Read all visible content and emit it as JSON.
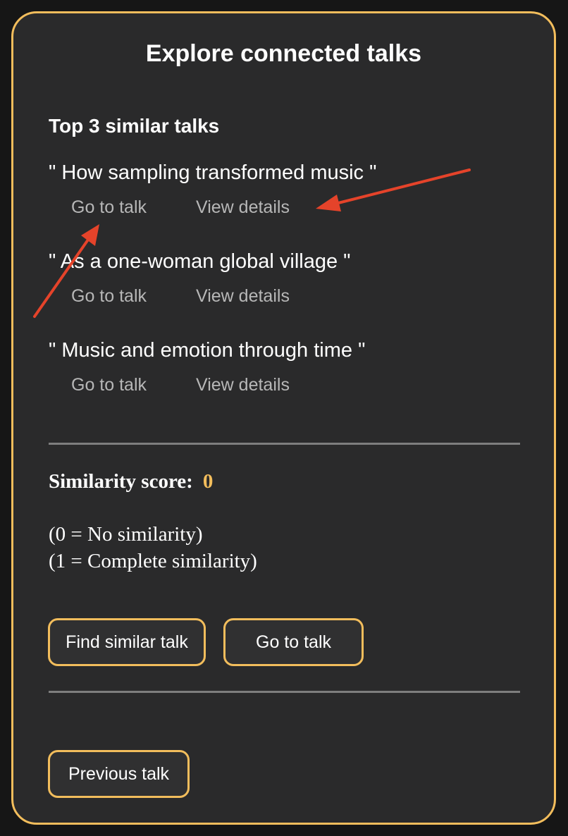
{
  "panel": {
    "title": "Explore connected talks",
    "accent_color": "#f2bd5c"
  },
  "similar_talks": {
    "heading": "Top 3 similar talks",
    "items": [
      {
        "title": "\" How sampling transformed music \"",
        "go_label": "Go to talk",
        "details_label": "View details"
      },
      {
        "title": "\" As a one-woman global village \"",
        "go_label": "Go to talk",
        "details_label": "View details"
      },
      {
        "title": "\" Music and emotion through time \"",
        "go_label": "Go to talk",
        "details_label": "View details"
      }
    ]
  },
  "similarity": {
    "label": "Similarity score:",
    "value": "0",
    "legend_zero": "(0 = No similarity)",
    "legend_one": "(1 = Complete similarity)"
  },
  "actions": {
    "find_similar_label": "Find similar talk",
    "go_to_talk_label": "Go to talk",
    "previous_label": "Previous talk"
  },
  "annotations": {
    "arrow_color": "#e5432a"
  }
}
